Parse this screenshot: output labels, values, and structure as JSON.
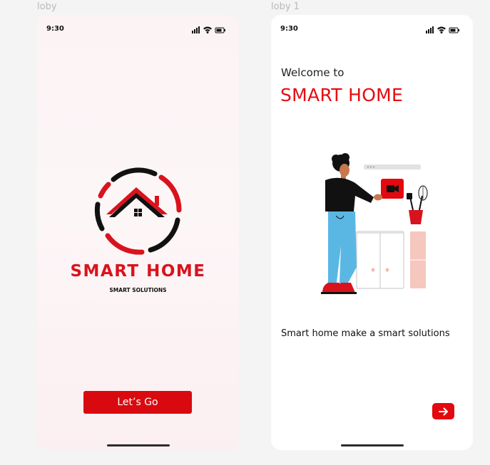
{
  "frames": [
    {
      "label": "loby"
    },
    {
      "label": "loby 1"
    }
  ],
  "status_bar": {
    "time": "9:30"
  },
  "splash": {
    "brand": "SMART HOME",
    "tagline": "SMART SOLUTIONS",
    "button_label": "Let’s Go"
  },
  "onboarding": {
    "welcome": "Welcome to",
    "title": "SMART HOME",
    "description": "Smart home make a smart solutions",
    "next_icon": "arrow-right-icon"
  },
  "colors": {
    "accent_red": "#e3090f",
    "brand_red": "#d9131d",
    "text_dark": "#111111"
  }
}
